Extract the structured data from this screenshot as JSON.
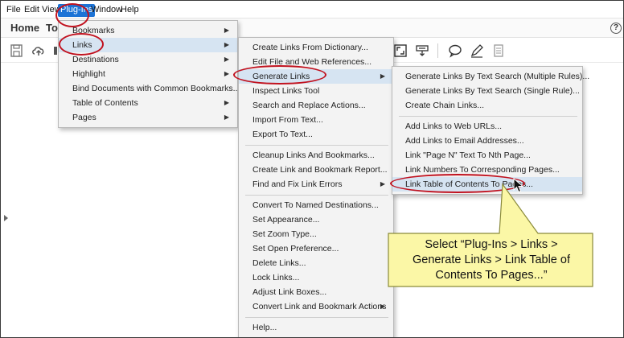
{
  "menubar": {
    "items": [
      "File",
      "Edit",
      "View",
      "Plug-Ins",
      "Window",
      "Help"
    ],
    "active": "Plug-Ins"
  },
  "toolbar": {
    "tabs": [
      "Home",
      "To"
    ],
    "help_icon_text": "?"
  },
  "plugins_menu": {
    "items": [
      {
        "label": "Bookmarks",
        "submenu": true
      },
      {
        "label": "Links",
        "submenu": true,
        "highlighted": true
      },
      {
        "label": "Destinations",
        "submenu": true
      },
      {
        "label": "Highlight",
        "submenu": true
      },
      {
        "label": "Bind Documents with Common Bookmarks...",
        "submenu": false
      },
      {
        "label": "Table of Contents",
        "submenu": true
      },
      {
        "label": "Pages",
        "submenu": true
      }
    ]
  },
  "links_menu": {
    "items": [
      {
        "label": "Create Links From Dictionary..."
      },
      {
        "label": "Edit File and Web References..."
      },
      {
        "label": "Generate Links",
        "submenu": true,
        "highlighted": true
      },
      {
        "label": "Inspect Links Tool"
      },
      {
        "label": "Search and Replace Actions..."
      },
      {
        "label": "Import From Text..."
      },
      {
        "label": "Export To Text..."
      },
      {
        "label": "Cleanup Links And Bookmarks..."
      },
      {
        "label": "Create Link and Bookmark Report..."
      },
      {
        "label": "Find and Fix Link Errors",
        "submenu": true
      },
      {
        "label": "Convert To Named Destinations..."
      },
      {
        "label": "Set Appearance..."
      },
      {
        "label": "Set Zoom Type..."
      },
      {
        "label": "Set Open Preference..."
      },
      {
        "label": "Delete Links..."
      },
      {
        "label": "Lock Links..."
      },
      {
        "label": "Adjust Link Boxes..."
      },
      {
        "label": "Convert Link and Bookmark Actions",
        "submenu": true
      },
      {
        "label": "Help..."
      }
    ]
  },
  "generate_links_menu": {
    "items": [
      {
        "label": "Generate Links By Text Search (Multiple Rules)..."
      },
      {
        "label": "Generate Links By Text Search (Single Rule)..."
      },
      {
        "label": "Create Chain Links..."
      },
      {
        "label": "Add Links to Web URLs..."
      },
      {
        "label": "Add Links to Email Addresses..."
      },
      {
        "label": "Link \"Page N\" Text To Nth Page..."
      },
      {
        "label": "Link Numbers To Corresponding Pages..."
      },
      {
        "label": "Link Table of Contents To Pages...",
        "highlighted": true
      }
    ]
  },
  "callout": {
    "line1": "Select “Plug-Ins > Links >",
    "line2": "Generate Links > Link Table of",
    "line3": "Contents To Pages...”",
    "fill": "#fbf7a6",
    "border": "#8a8a3a"
  },
  "colors": {
    "accent": "#1c73d6",
    "ring": "#c1121f",
    "menu_highlight": "#d6e4f2"
  }
}
